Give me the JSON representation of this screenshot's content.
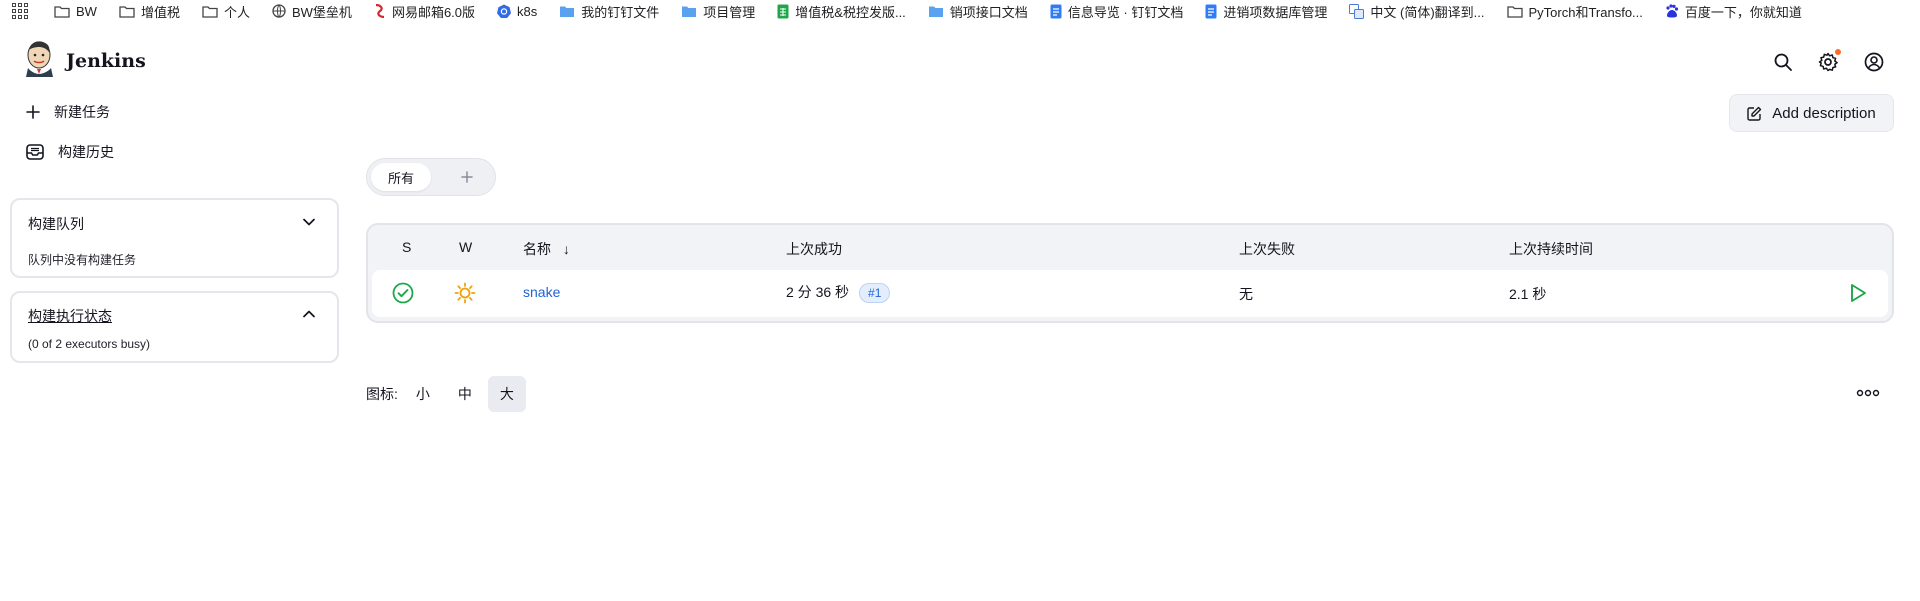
{
  "bookmarks": [
    {
      "label": "BW",
      "icon": "folder-icon"
    },
    {
      "label": "增值税",
      "icon": "folder-icon"
    },
    {
      "label": "个人",
      "icon": "folder-icon"
    },
    {
      "label": "BW堡垒机",
      "icon": "globe-icon"
    },
    {
      "label": "网易邮箱6.0版",
      "icon": "netease-mail-icon"
    },
    {
      "label": "k8s",
      "icon": "kubernetes-icon"
    },
    {
      "label": "我的钉钉文件",
      "icon": "folder-icon"
    },
    {
      "label": "项目管理",
      "icon": "folder-icon"
    },
    {
      "label": "增值税&税控发版...",
      "icon": "sheet-icon"
    },
    {
      "label": "销项接口文档",
      "icon": "folder-icon"
    },
    {
      "label": "信息导览 · 钉钉文档",
      "icon": "doc-icon"
    },
    {
      "label": "进销项数据库管理",
      "icon": "doc-icon"
    },
    {
      "label": "中文 (简体)翻译到...",
      "icon": "translate-icon"
    },
    {
      "label": "PyTorch和Transfo...",
      "icon": "folder-icon"
    },
    {
      "label": "百度一下，你就知道",
      "icon": "baidu-icon"
    }
  ],
  "header": {
    "brand": "Jenkins"
  },
  "sidebar": {
    "tasks": [
      {
        "label": "新建任务",
        "icon": "plus-icon"
      },
      {
        "label": "构建历史",
        "icon": "inbox-icon"
      }
    ],
    "build_queue": {
      "title": "构建队列",
      "empty_text": "队列中没有构建任务"
    },
    "executor_status": {
      "title": "构建执行状态",
      "summary": "(0 of 2 executors busy)"
    }
  },
  "main": {
    "add_description": "Add description",
    "tabs": [
      {
        "label": "所有",
        "active": true
      }
    ],
    "table": {
      "headers": {
        "s": "S",
        "w": "W",
        "name": "名称",
        "sort_indicator": "↓",
        "last_success": "上次成功",
        "last_failure": "上次失败",
        "last_duration": "上次持续时间"
      },
      "rows": [
        {
          "status": "success",
          "weather": "sunny",
          "name": "snake",
          "last_success": "2 分 36 秒",
          "last_success_build": "#1",
          "last_failure": "无",
          "last_duration": "2.1 秒"
        }
      ]
    },
    "icon_size": {
      "label": "图标:",
      "options": [
        "小",
        "中",
        "大"
      ],
      "selected": "大"
    }
  },
  "colors": {
    "success": "#1ea64b",
    "weather": "#f0a20a",
    "link": "#1f63d6",
    "notification": "#ff6a2b"
  }
}
